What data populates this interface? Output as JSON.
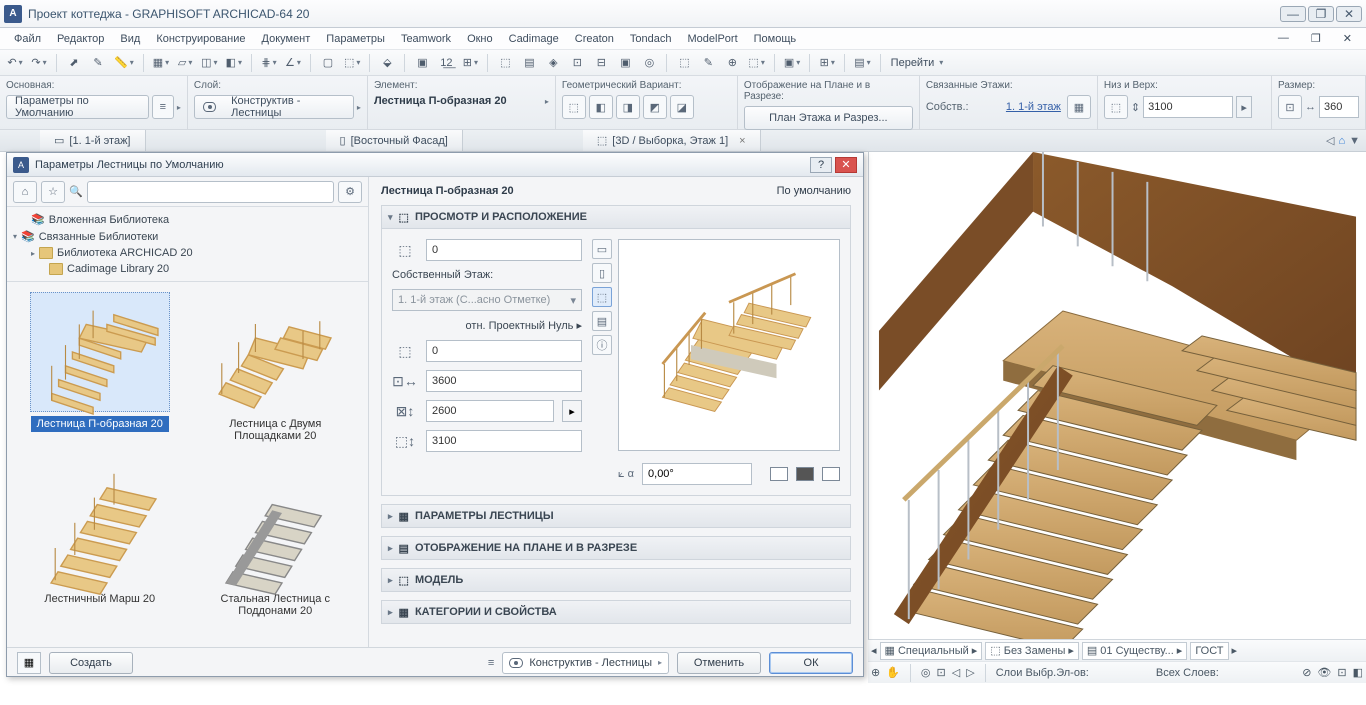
{
  "titlebar": {
    "text": "Проект коттеджа - GRAPHISOFT ARCHICAD-64 20"
  },
  "menu": [
    "Файл",
    "Редактор",
    "Вид",
    "Конструирование",
    "Документ",
    "Параметры",
    "Teamwork",
    "Окно",
    "Cadimage",
    "Creaton",
    "Tondach",
    "ModelPort",
    "Помощь"
  ],
  "toolbar": {
    "navigate": "Перейти"
  },
  "infobar": {
    "c0": {
      "lab": "Основная:",
      "btn": "Параметры по Умолчанию"
    },
    "c1": {
      "lab": "Слой:",
      "btn": "Конструктив - Лестницы"
    },
    "c2": {
      "lab": "Элемент:",
      "text": "Лестница П-образная 20"
    },
    "c3": {
      "lab": "Геометрический Вариант:"
    },
    "c4": {
      "lab": "Отображение на Плане и в Разрезе:",
      "btn": "План Этажа и Разрез..."
    },
    "c5": {
      "lab": "Связанные Этажи:",
      "sub": "Собств.:",
      "link": "1. 1-й этаж"
    },
    "c6": {
      "lab": "Низ и Верх:",
      "val": "3100"
    },
    "c7": {
      "lab": "Размер:",
      "val": "360"
    }
  },
  "tabs": {
    "t0": "[1. 1-й этаж]",
    "t1": "[Восточный Фасад]",
    "t2": "[3D / Выборка, Этаж 1]"
  },
  "dialog": {
    "title": "Параметры Лестницы по Умолчанию",
    "tree": {
      "n0": "Вложенная Библиотека",
      "n1": "Связанные Библиотеки",
      "n2": "Библиотека ARCHICAD 20",
      "n3": "Cadimage Library 20"
    },
    "gallery": {
      "g0": "Лестница П-образная 20",
      "g1": "Лестница с Двумя Площадками 20",
      "g2": "Лестничный Марш 20",
      "g3": "Стальная Лестница с Поддонами 20"
    },
    "right": {
      "title": "Лестница П-образная 20",
      "default": "По умолчанию",
      "panels": {
        "p0": "ПРОСМОТР И РАСПОЛОЖЕНИЕ",
        "p1": "ПАРАМЕТРЫ ЛЕСТНИЦЫ",
        "p2": "ОТОБРАЖЕНИЕ НА ПЛАНЕ И В РАЗРЕЗЕ",
        "p3": "МОДЕЛЬ",
        "p4": "КАТЕГОРИИ И СВОЙСТВА"
      },
      "params": {
        "offset": "0",
        "ownstory_label": "Собственный Этаж:",
        "ownstory_value": "1. 1-й этаж (С...асно Отметке)",
        "refnull": "отн. Проектный Нуль  ▸",
        "refnull_val": "0",
        "v1": "3600",
        "v2": "2600",
        "v3": "3100",
        "angle": "0,00°"
      }
    },
    "foot": {
      "create": "Создать",
      "layer": "Конструктив - Лестницы",
      "cancel": "Отменить",
      "ok": "ОК"
    }
  },
  "status": {
    "s0": "Специальный",
    "s1": "Без Замены",
    "s2": "01 Существу...",
    "s3": "ГОСТ",
    "s4": "Слои Выбр.Эл-ов:",
    "s5": "Всех Слоев:"
  }
}
